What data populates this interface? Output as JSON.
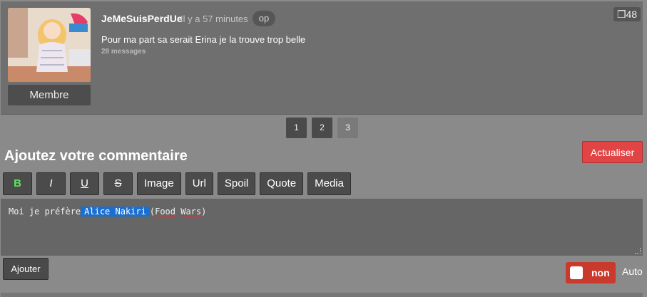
{
  "comment": {
    "author": "JeMeSuisPerdUe",
    "time": "Il y a 57 minutes",
    "badge": "op",
    "text": "Pour ma part sa serait Erina je la trouve trop belle",
    "message_count": "28 messages",
    "rank": "Membre",
    "vote": "❒48"
  },
  "pagination": {
    "pages": [
      "1",
      "2",
      "3"
    ],
    "current": "3"
  },
  "compose": {
    "title": "Ajoutez votre commentaire",
    "refresh_label": "Actualiser",
    "toolbar": {
      "bold": "B",
      "italic": "I",
      "underline": "U",
      "strike": "S",
      "image": "Image",
      "url": "Url",
      "spoil": "Spoil",
      "quote": "Quote",
      "media": "Media"
    },
    "editor": {
      "before": "Moi je préfère",
      "selected": "Alice Nakiri",
      "paren_open": "(",
      "spell1": "Food",
      "space": " ",
      "spell2": "Wars",
      "paren_close": ")"
    },
    "submit_label": "Ajouter",
    "auto_toggle": {
      "state": "non",
      "label": "Auto"
    }
  },
  "colors": {
    "accent_red": "#e04444",
    "toggle_red": "#c9392c",
    "bold_green": "#5ce65c",
    "selection_blue": "#1a6fd0"
  }
}
